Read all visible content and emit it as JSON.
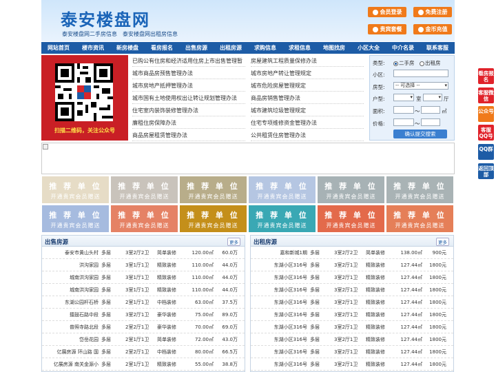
{
  "header": {
    "title": "泰安楼盘网",
    "subtitle": "泰安楼盘网二手房信息　泰安楼盘网出租房信息",
    "buttons": [
      {
        "label": "会员登录",
        "icon": "user-icon"
      },
      {
        "label": "免费注册",
        "icon": "register-icon"
      },
      {
        "label": "贵宾套餐",
        "icon": "vip-icon"
      },
      {
        "label": "金币充值",
        "icon": "coin-icon"
      }
    ]
  },
  "nav": [
    "网站首页",
    "楼市资讯",
    "新房楼盘",
    "看房报名",
    "出售房源",
    "出租房源",
    "求购信息",
    "求租信息",
    "地图找房",
    "小区大全",
    "中介名录",
    "联系客服"
  ],
  "qr": {
    "caption": "扫描二维码，关注公众号"
  },
  "news": {
    "left": [
      "已购公有住房和经济适用住房上市出售管理暂",
      "城市商品房预售管理办法",
      "城市房地产抵押管理办法",
      "城市国有土地使用权出让转让规划管理办法",
      "住宅室内装饰装修管理办法",
      "廉租住房保障办法",
      "商品房屋租赁管理办法"
    ],
    "right": [
      "房屋建筑工程质量保修办法",
      "城市房地产转让管理规定",
      "城市危险房屋管理规定",
      "商品房销售管理办法",
      "城市建筑垃圾管理规定",
      "住宅专项维修资金管理办法",
      "公共租赁住房管理办法"
    ]
  },
  "search": {
    "type_label": "类型:",
    "type_options": [
      "二手房",
      "出租房"
    ],
    "community_label": "小区:",
    "layout_label": "房型:",
    "layout_select": "-- 可选择 --",
    "rooms_label": "户型:",
    "room_unit": "室",
    "hall_unit": "厅",
    "area_label": "面积:",
    "area_unit": "㎡",
    "price_label": "价格:",
    "range_sep": "～",
    "submit": "确认提交搜索"
  },
  "ads": {
    "line1": "推 荐 单 位",
    "line2": "开通贵宾会员赠送",
    "colors": [
      "#e6dcc6",
      "#c9c3bb",
      "#b8ad8a",
      "#b5c6e2",
      "#a7b2b5",
      "#a9b3b5",
      "#a6bbdf",
      "#e58265",
      "#c48f1a",
      "#3aa8b4",
      "#e36a4b",
      "#e57f58"
    ]
  },
  "sale": {
    "title": "出售房源",
    "more": "更多",
    "rows": [
      [
        "泰安市黄山头村",
        "多层",
        "3室2厅2卫",
        "简单装修",
        "120.00㎡",
        "60.0万"
      ],
      [
        "洪沟家园",
        "多层",
        "3室1厅1卫",
        "精致装修",
        "110.00㎡",
        "44.0万"
      ],
      [
        "城南洪沟家园",
        "多层",
        "3室1厅1卫",
        "精致装修",
        "110.00㎡",
        "44.0万"
      ],
      [
        "城南洪沟家园",
        "多层",
        "3室1厅1卫",
        "精致装修",
        "110.00㎡",
        "44.0万"
      ],
      [
        "东湖公园杆石桥",
        "多层",
        "2室1厅1卫",
        "中档装修",
        "63.00㎡",
        "37.5万"
      ],
      [
        "擂鼓石路中段",
        "多层",
        "3室2厅1卫",
        "豪华装修",
        "75.00㎡",
        "89.0万"
      ],
      [
        "普照寺路北段",
        "多层",
        "2室2厅1卫",
        "豪华装修",
        "70.00㎡",
        "69.0万"
      ],
      [
        "岱岳花园",
        "多层",
        "2室1厅1卫",
        "简单装修",
        "72.00㎡",
        "43.0万"
      ],
      [
        "亿展房源 环山路 国",
        "多层",
        "2室2厅1卫",
        "中档装修",
        "80.00㎡",
        "66.5万"
      ],
      [
        "亿展房源 南关金源小",
        "多层",
        "2室1厅1卫",
        "精致装修",
        "55.00㎡",
        "38.8万"
      ]
    ]
  },
  "rent": {
    "title": "出租房源",
    "more": "更多",
    "rows": [
      [
        "嘉和新城1期",
        "多层",
        "3室2厅2卫",
        "简单装修",
        "138.00㎡",
        "900元"
      ],
      [
        "东湖小区316号",
        "多层",
        "3室2厅1卫",
        "精致装修",
        "127.44㎡",
        "1800元"
      ],
      [
        "东湖小区316号",
        "多层",
        "3室2厅1卫",
        "精致装修",
        "127.44㎡",
        "1800元"
      ],
      [
        "东湖小区316号",
        "多层",
        "3室2厅1卫",
        "精致装修",
        "127.44㎡",
        "1800元"
      ],
      [
        "东湖小区316号",
        "多层",
        "3室2厅1卫",
        "精致装修",
        "127.44㎡",
        "1800元"
      ],
      [
        "东湖小区316号",
        "多层",
        "3室2厅1卫",
        "精致装修",
        "127.44㎡",
        "1800元"
      ],
      [
        "东湖小区316号",
        "多层",
        "3室2厅1卫",
        "精致装修",
        "127.44㎡",
        "1800元"
      ],
      [
        "东湖小区316号",
        "多层",
        "3室2厅1卫",
        "精致装修",
        "127.44㎡",
        "1800元"
      ],
      [
        "东湖小区316号",
        "多层",
        "3室2厅1卫",
        "精致装修",
        "127.44㎡",
        "1800元"
      ],
      [
        "东湖小区316号",
        "多层",
        "3室2厅1卫",
        "精致装修",
        "127.44㎡",
        "1800元"
      ]
    ]
  },
  "sidebar": [
    {
      "label": "看房报名",
      "color": "#e0222a"
    },
    {
      "label": "客服微信",
      "color": "#e0222a"
    },
    {
      "label": "公众号",
      "color": "#f07a1a"
    },
    {
      "label": "客服QQ号",
      "color": "#e0222a"
    },
    {
      "label": "QQ群",
      "color": "#1d5ca6"
    },
    {
      "label": "返回顶部",
      "color": "#1d5ca6"
    }
  ]
}
